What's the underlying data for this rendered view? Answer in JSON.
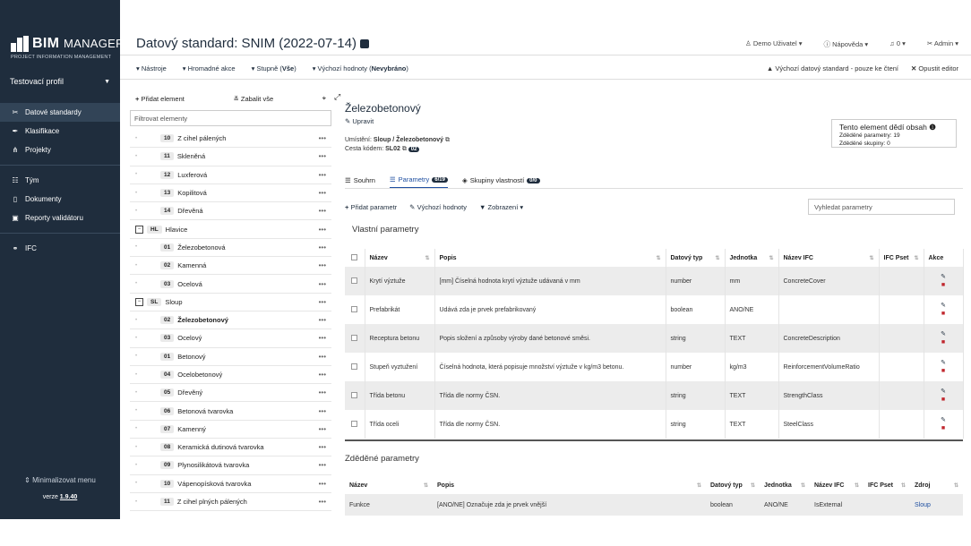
{
  "sidebar": {
    "logo_main": "BIM",
    "logo_rest": "MANAGER",
    "logo_sub": "PROJECT INFORMATION MANAGEMENT",
    "profile": "Testovací profil",
    "nav1": [
      {
        "label": "Datové standardy",
        "icon": "tools-icon"
      },
      {
        "label": "Klasifikace",
        "icon": "pen-icon"
      },
      {
        "label": "Projekty",
        "icon": "sitemap-icon"
      }
    ],
    "nav2": [
      {
        "label": "Tým",
        "icon": "team-icon"
      },
      {
        "label": "Dokumenty",
        "icon": "document-icon"
      },
      {
        "label": "Reporty validátoru",
        "icon": "report-icon"
      }
    ],
    "nav3": [
      {
        "label": "IFC",
        "icon": "ifc-icon"
      }
    ],
    "minimize": "Minimalizovat menu",
    "version_prefix": "verze ",
    "version": "1.9.40"
  },
  "header": {
    "title": "Datový standard: SNIM (2022-07-14)",
    "user": "Demo Uživatel",
    "help": "Nápověda",
    "notifications": "0",
    "admin": "Admin"
  },
  "toolbar": {
    "tools": "Nástroje",
    "bulk": "Hromadné akce",
    "levels_prefix": "Stupně (",
    "levels_value": "Vše",
    "levels_suffix": ")",
    "defaults_prefix": "Výchozí hodnoty (",
    "defaults_value": "Nevybráno",
    "defaults_suffix": ")",
    "readonly": "Výchozí datový standard - pouze ke čtení",
    "exit": "Opustit editor"
  },
  "tree": {
    "add": "Přidat element",
    "collapse": "Zabalit vše",
    "filter_placeholder": "Filtrovat elementy",
    "rows": [
      {
        "code": "10",
        "label": "Z cihel pálených",
        "group": false
      },
      {
        "code": "11",
        "label": "Skleněná",
        "group": false
      },
      {
        "code": "12",
        "label": "Luxferová",
        "group": false
      },
      {
        "code": "13",
        "label": "Kopilitová",
        "group": false
      },
      {
        "code": "14",
        "label": "Dřevěná",
        "group": false
      },
      {
        "code": "HL",
        "label": "Hlavice",
        "group": true
      },
      {
        "code": "01",
        "label": "Železobetonová",
        "group": false
      },
      {
        "code": "02",
        "label": "Kamenná",
        "group": false
      },
      {
        "code": "03",
        "label": "Ocelová",
        "group": false
      },
      {
        "code": "SL",
        "label": "Sloup",
        "group": true
      },
      {
        "code": "02",
        "label": "Železobetonový",
        "group": false,
        "selected": true
      },
      {
        "code": "03",
        "label": "Ocelový",
        "group": false
      },
      {
        "code": "01",
        "label": "Betonový",
        "group": false
      },
      {
        "code": "04",
        "label": "Ocelobetonový",
        "group": false
      },
      {
        "code": "05",
        "label": "Dřevěný",
        "group": false
      },
      {
        "code": "06",
        "label": "Betonová tvarovka",
        "group": false
      },
      {
        "code": "07",
        "label": "Kamenný",
        "group": false
      },
      {
        "code": "08",
        "label": "Keramická dutinová tvarovka",
        "group": false
      },
      {
        "code": "09",
        "label": "Plynosilikátová tvarovka",
        "group": false
      },
      {
        "code": "10",
        "label": "Vápenopísková tvarovka",
        "group": false
      },
      {
        "code": "11",
        "label": "Z cihel plných pálených",
        "group": false
      }
    ]
  },
  "element": {
    "title": "Železobetonový",
    "edit": "Upravit",
    "location_label": "Umístění: ",
    "location": "Sloup / Železobetonový",
    "code_label": "Cesta kódem: ",
    "code": "SL02",
    "code_badge": "02",
    "inherit_title": "Tento element dědí obsah",
    "inherit_params": "Zděděné parametry: 19",
    "inherit_groups": "Zděděné skupiny: 0"
  },
  "tabs": [
    {
      "label": "Souhrn",
      "badge": ""
    },
    {
      "label": "Parametry",
      "badge": "6/19"
    },
    {
      "label": "Skupiny vlastností",
      "badge": "0/0"
    }
  ],
  "actions": {
    "add_param": "Přidat parametr",
    "defaults": "Výchozí hodnoty",
    "view": "Zobrazení",
    "search_placeholder": "Vyhledat parametry"
  },
  "own_params": {
    "title": "Vlastní parametry",
    "headers": [
      "Název",
      "Popis",
      "Datový typ",
      "Jednotka",
      "Název IFC",
      "IFC Pset",
      "Akce"
    ],
    "rows": [
      [
        "Krytí výztuže",
        "[mm] Číselná hodnota krytí výztuže udávaná v mm",
        "number",
        "mm",
        "ConcreteCover",
        ""
      ],
      [
        "Prefabrikát",
        "Udává zda je prvek prefabrikovaný",
        "boolean",
        "ANO/NE",
        "",
        ""
      ],
      [
        "Receptura betonu",
        "Popis složení a způsoby výroby dané betonové směsi.",
        "string",
        "TEXT",
        "ConcreteDescription",
        ""
      ],
      [
        "Stupeň vyztužení",
        "Číselná hodnota, která popisuje množství výztuže v kg/m3 betonu.",
        "number",
        "kg/m3",
        "ReinforcementVolumeRatio",
        ""
      ],
      [
        "Třída betonu",
        "Třída dle normy ČSN.",
        "string",
        "TEXT",
        "StrengthClass",
        ""
      ],
      [
        "Třída oceli",
        "Třída dle normy ČSN.",
        "string",
        "TEXT",
        "SteelClass",
        ""
      ]
    ]
  },
  "inherited_params": {
    "title": "Zděděné parametry",
    "headers": [
      "Název",
      "Popis",
      "Datový typ",
      "Jednotka",
      "Název IFC",
      "IFC Pset",
      "Zdroj"
    ],
    "rows": [
      [
        "Funkce",
        "[ANO/NE] Označuje zda je prvek vnější",
        "boolean",
        "ANO/NE",
        "IsExternal",
        "",
        "Sloup"
      ]
    ]
  }
}
